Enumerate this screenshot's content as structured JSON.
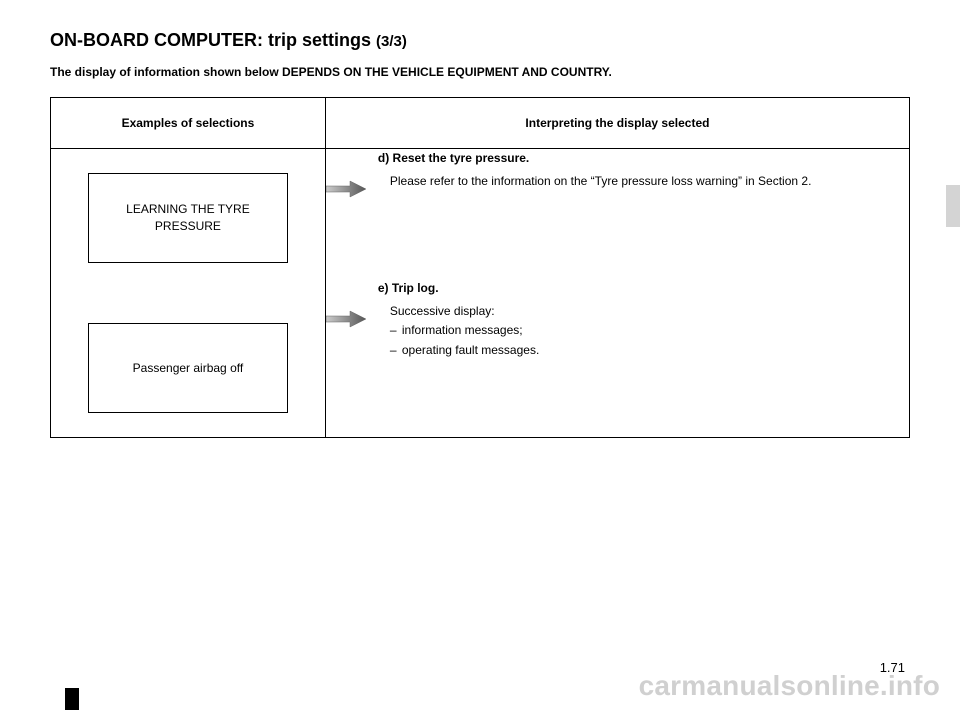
{
  "title_main": "ON-BOARD COMPUTER: trip settings ",
  "title_sub": "(3/3)",
  "subtitle": "The display of information shown below DEPENDS ON THE VEHICLE EQUIPMENT AND COUNTRY.",
  "table": {
    "header_left": "Examples of selections",
    "header_right": "Interpreting the display selected",
    "rows": [
      {
        "display_text": "LEARNING THE  TYRE PRESSURE",
        "interpret": {
          "title": "d) Reset the tyre pressure.",
          "lines": [
            {
              "type": "indent",
              "text": "Please refer to the information on the “Tyre pressure loss warning” in Section 2."
            }
          ]
        }
      },
      {
        "display_text": "Passenger airbag off",
        "interpret": {
          "title": "e) Trip log.",
          "lines": [
            {
              "type": "indent",
              "text": "Successive display:"
            },
            {
              "type": "bullet",
              "text": "information messages;"
            },
            {
              "type": "bullet",
              "text": "operating fault messages."
            }
          ]
        }
      }
    ]
  },
  "page_number": "1.71",
  "watermark": "carmanualsonline.info"
}
